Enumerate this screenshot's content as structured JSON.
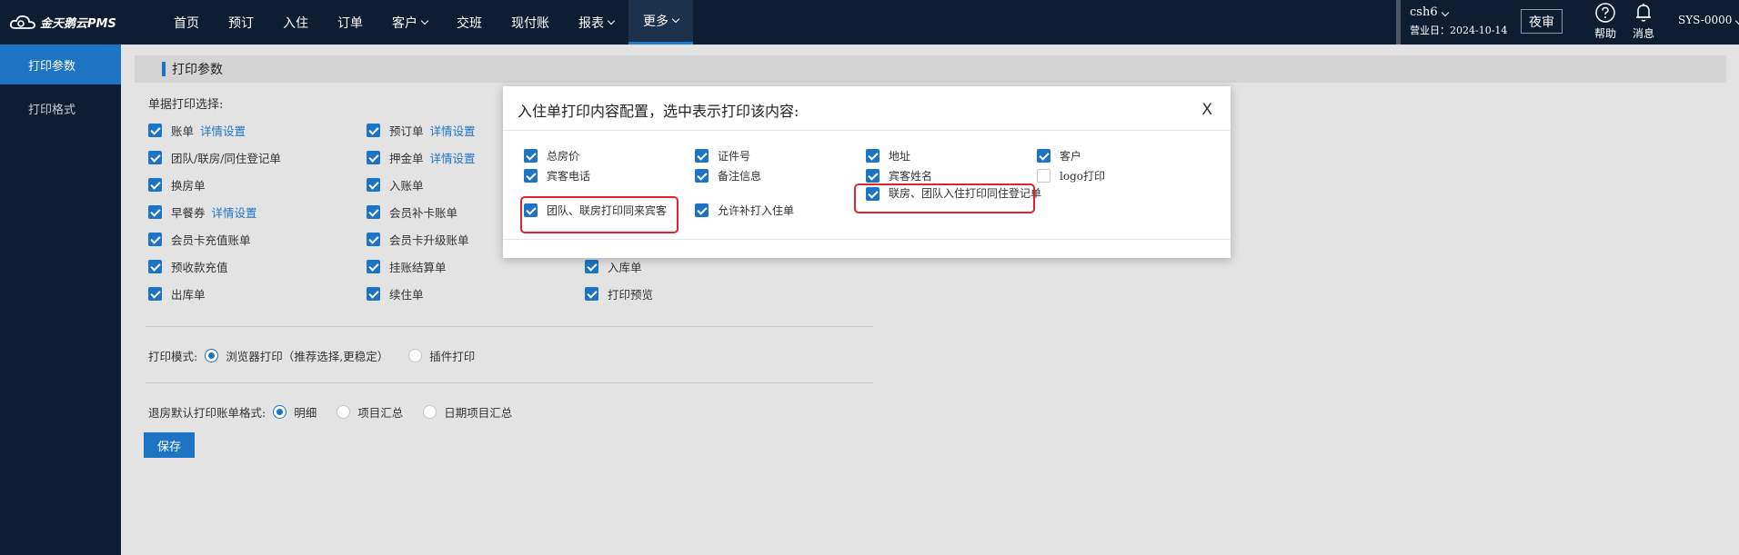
{
  "app": {
    "logo_text": "金天鹅云PMS",
    "nav": [
      {
        "label": "首页",
        "has_menu": false
      },
      {
        "label": "预订",
        "has_menu": false
      },
      {
        "label": "入住",
        "has_menu": false
      },
      {
        "label": "订单",
        "has_menu": false
      },
      {
        "label": "客户",
        "has_menu": true
      },
      {
        "label": "交班",
        "has_menu": false
      },
      {
        "label": "现付账",
        "has_menu": false
      },
      {
        "label": "报表",
        "has_menu": true
      },
      {
        "label": "更多",
        "has_menu": true,
        "active": true
      }
    ],
    "user": "csh6",
    "business_date": "营业日：2024-10-14",
    "night_audit": "夜审",
    "help": "帮助",
    "messages": "消息",
    "sys_user": "SYS-0000",
    "colors": {
      "nav_bg": "#0d1e33",
      "accent": "#1e74c4",
      "highlight": "#e0242b"
    }
  },
  "sidebar": {
    "items": [
      {
        "label": "打印参数",
        "active": true
      },
      {
        "label": "打印格式",
        "active": false
      }
    ]
  },
  "page": {
    "section_title": "打印参数",
    "doc_select_label": "单据打印选择:",
    "docs": [
      {
        "label": "账单",
        "checked": true,
        "link": "详情设置"
      },
      {
        "label": "预订单",
        "checked": true,
        "link": "详情设置"
      },
      {
        "label": "团队/联房/同住登记单",
        "checked": true,
        "link": ""
      },
      {
        "label": "押金单",
        "checked": true,
        "link": "详情设置"
      },
      {
        "label": "换房单",
        "checked": true,
        "link": ""
      },
      {
        "label": "入账单",
        "checked": true,
        "link": ""
      },
      {
        "label": "早餐券",
        "checked": true,
        "link": "详情设置"
      },
      {
        "label": "会员补卡账单",
        "checked": true,
        "link": ""
      },
      {
        "label": "会员卡充值账单",
        "checked": true,
        "link": ""
      },
      {
        "label": "会员卡升级账单",
        "checked": true,
        "link": ""
      },
      {
        "label": "预收款充值",
        "checked": true,
        "link": ""
      },
      {
        "label": "挂账结算单",
        "checked": true,
        "link": ""
      },
      {
        "label": "入库单",
        "checked": true,
        "link": ""
      },
      {
        "label": "出库单",
        "checked": true,
        "link": ""
      },
      {
        "label": "续住单",
        "checked": true,
        "link": ""
      },
      {
        "label": "打印预览",
        "checked": true,
        "link": ""
      }
    ],
    "print_mode": {
      "label": "打印模式:",
      "options": [
        {
          "label": "浏览器打印（推荐选择,更稳定）",
          "selected": true
        },
        {
          "label": "插件打印",
          "selected": false
        }
      ]
    },
    "checkout_format": {
      "label": "退房默认打印账单格式:",
      "options": [
        {
          "label": "明细",
          "selected": true
        },
        {
          "label": "项目汇总",
          "selected": false
        },
        {
          "label": "日期项目汇总",
          "selected": false
        }
      ]
    },
    "save_label": "保存"
  },
  "modal": {
    "title": "入住单打印内容配置，选中表示打印该内容:",
    "close_label": "X",
    "options": [
      {
        "label": "总房价",
        "checked": true
      },
      {
        "label": "证件号",
        "checked": true
      },
      {
        "label": "地址",
        "checked": true
      },
      {
        "label": "客户",
        "checked": true
      },
      {
        "label": "宾客电话",
        "checked": true
      },
      {
        "label": "备注信息",
        "checked": true
      },
      {
        "label": "宾客姓名",
        "checked": true
      },
      {
        "label": "logo打印",
        "checked": false
      },
      {
        "label": "团队、联房打印同来宾客",
        "checked": true
      },
      {
        "label": "允许补打入住单",
        "checked": true
      },
      {
        "label": "联房、团队入住打印同住登记单",
        "checked": true
      }
    ]
  }
}
